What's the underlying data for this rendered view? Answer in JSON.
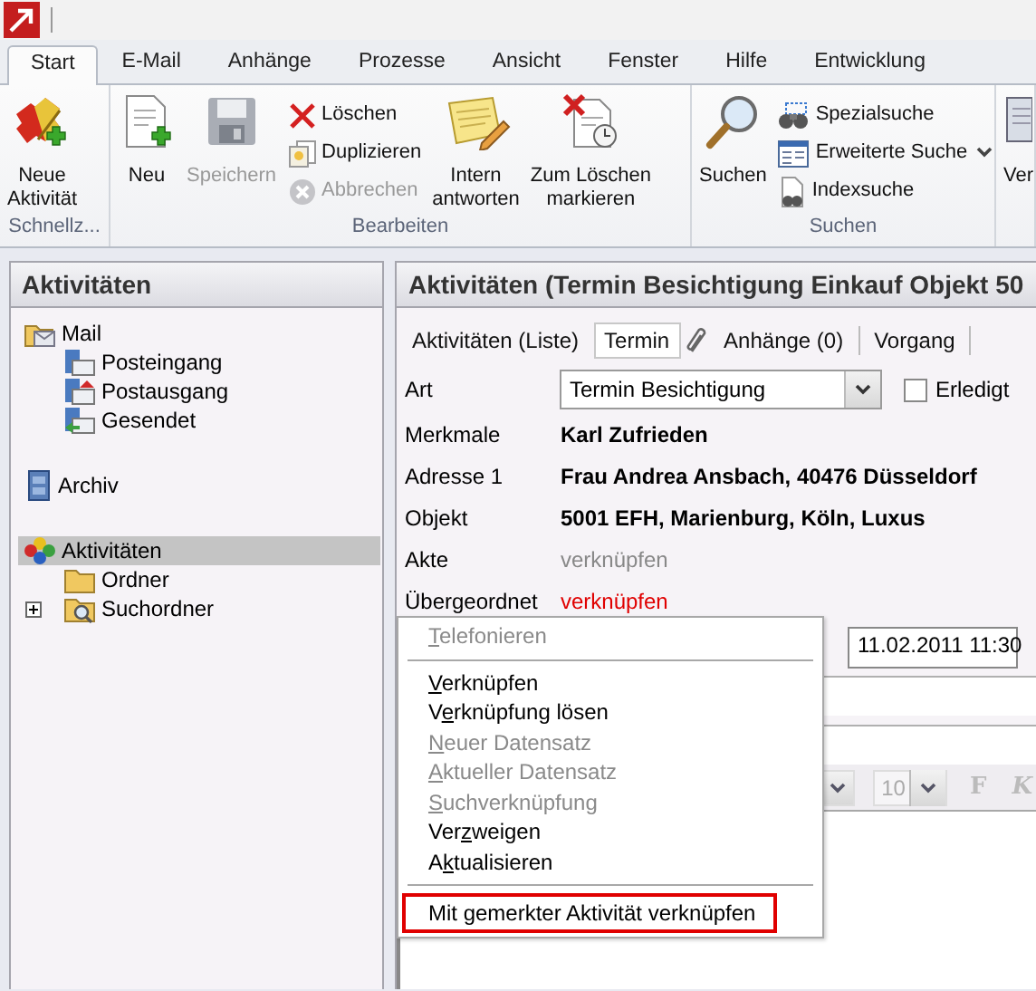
{
  "ribbon": {
    "tabs": [
      {
        "label": "Start",
        "selected": true
      },
      {
        "label": "E-Mail",
        "selected": false
      },
      {
        "label": "Anhänge",
        "selected": false
      },
      {
        "label": "Prozesse",
        "selected": false
      },
      {
        "label": "Ansicht",
        "selected": false
      },
      {
        "label": "Fenster",
        "selected": false
      },
      {
        "label": "Hilfe",
        "selected": false
      },
      {
        "label": "Entwicklung",
        "selected": false
      }
    ],
    "groups": [
      {
        "label": "Schnellz...",
        "controls": [
          {
            "kind": "large",
            "lines": [
              "Neue",
              "Aktivität"
            ],
            "disabled": false
          }
        ]
      },
      {
        "label": "Bearbeiten",
        "controls": [
          {
            "kind": "large",
            "lines": [
              "Neu"
            ],
            "disabled": false
          },
          {
            "kind": "large",
            "lines": [
              "Speichern"
            ],
            "disabled": true
          },
          {
            "kind": "stack",
            "items": [
              {
                "label": "Löschen",
                "disabled": false,
                "dropdown": false
              },
              {
                "label": "Duplizieren",
                "disabled": false,
                "dropdown": false
              },
              {
                "label": "Abbrechen",
                "disabled": true,
                "dropdown": false
              }
            ]
          },
          {
            "kind": "large",
            "lines": [
              "Intern",
              "antworten"
            ],
            "disabled": false
          },
          {
            "kind": "large",
            "lines": [
              "Zum Löschen",
              "markieren"
            ],
            "disabled": false
          }
        ]
      },
      {
        "label": "Suchen",
        "controls": [
          {
            "kind": "large",
            "lines": [
              "Suchen"
            ],
            "disabled": false
          },
          {
            "kind": "stack",
            "items": [
              {
                "label": "Spezialsuche",
                "disabled": false,
                "dropdown": false
              },
              {
                "label": "Erweiterte Suche",
                "disabled": false,
                "dropdown": true
              },
              {
                "label": "Indexsuche",
                "disabled": false,
                "dropdown": false
              }
            ]
          }
        ]
      },
      {
        "controls": [
          {
            "kind": "large",
            "lines": [
              "Ver"
            ],
            "disabled": false
          }
        ]
      }
    ]
  },
  "sidebar": {
    "title": "Aktivitäten",
    "items": [
      {
        "label": "Mail",
        "selected": false,
        "children": [
          {
            "label": "Posteingang",
            "selected": false
          },
          {
            "label": "Postausgang",
            "selected": false
          },
          {
            "label": "Gesendet",
            "selected": false
          }
        ]
      },
      {
        "label": "Archiv",
        "selected": false
      },
      {
        "label": "Aktivitäten",
        "selected": true,
        "children": [
          {
            "label": "Ordner",
            "selected": false
          },
          {
            "label": "Suchordner",
            "selected": false,
            "expanded": false
          }
        ]
      }
    ]
  },
  "detail": {
    "title": "Aktivitäten (Termin Besichtigung Einkauf Objekt 50",
    "tabs": [
      {
        "label": "Aktivitäten (Liste)",
        "selected": false
      },
      {
        "label": "Termin",
        "selected": true
      },
      {
        "label": "Anhänge (0)",
        "selected": false
      },
      {
        "label": "Vorgang",
        "selected": false
      }
    ],
    "art": {
      "label": "Art",
      "value": "Termin Besichtigung"
    },
    "done": {
      "label": "Erledigt",
      "checked": false
    },
    "fields": [
      {
        "label": "Merkmale",
        "value": "Karl Zufrieden",
        "kind": "bold"
      },
      {
        "label": "Adresse 1",
        "value": "Frau Andrea Ansbach, 40476 Düsseldorf",
        "kind": "bold"
      },
      {
        "label": "Objekt",
        "value": "5001 EFH, Marienburg, Köln, Luxus",
        "kind": "bold"
      },
      {
        "label": "Akte",
        "value": "verknüpfen",
        "kind": "link"
      },
      {
        "label": "Übergeordnet",
        "value": "verknüpfen",
        "kind": "alert"
      }
    ],
    "date": "11.02.2011 11:30",
    "font_size": "10",
    "format_buttons": [
      "F",
      "K"
    ]
  },
  "context_menu": [
    {
      "kind": "item",
      "parts": [
        {
          "text": "T",
          "underline": true
        },
        {
          "text": "elefonieren",
          "underline": false
        }
      ],
      "disabled": true,
      "highlighted": false
    },
    {
      "kind": "separator"
    },
    {
      "kind": "item",
      "parts": [
        {
          "text": "V",
          "underline": true
        },
        {
          "text": "erknüpfen",
          "underline": false
        }
      ],
      "disabled": false,
      "highlighted": false
    },
    {
      "kind": "item",
      "parts": [
        {
          "text": "V",
          "underline": false
        },
        {
          "text": "e",
          "underline": true
        },
        {
          "text": "rknüpfung lösen",
          "underline": false
        }
      ],
      "disabled": false,
      "highlighted": false
    },
    {
      "kind": "item",
      "parts": [
        {
          "text": "N",
          "underline": true
        },
        {
          "text": "euer Datensatz",
          "underline": false
        }
      ],
      "disabled": true,
      "highlighted": false
    },
    {
      "kind": "item",
      "parts": [
        {
          "text": "A",
          "underline": true
        },
        {
          "text": "ktueller Datensatz",
          "underline": false
        }
      ],
      "disabled": true,
      "highlighted": false
    },
    {
      "kind": "item",
      "parts": [
        {
          "text": "S",
          "underline": true
        },
        {
          "text": "uchverknüpfung",
          "underline": false
        }
      ],
      "disabled": true,
      "highlighted": false
    },
    {
      "kind": "item",
      "parts": [
        {
          "text": "Ver",
          "underline": false
        },
        {
          "text": "z",
          "underline": true
        },
        {
          "text": "weigen",
          "underline": false
        }
      ],
      "disabled": false,
      "highlighted": false
    },
    {
      "kind": "item",
      "parts": [
        {
          "text": "A",
          "underline": false
        },
        {
          "text": "k",
          "underline": true
        },
        {
          "text": "tualisieren",
          "underline": false
        }
      ],
      "disabled": false,
      "highlighted": false
    },
    {
      "kind": "separator"
    },
    {
      "kind": "item",
      "parts": [
        {
          "text": "Mit gemerkter Aktivität verknüpfen",
          "underline": false
        }
      ],
      "disabled": false,
      "highlighted": true
    }
  ]
}
